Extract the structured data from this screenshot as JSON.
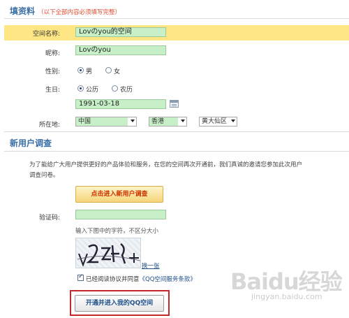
{
  "section1": {
    "title": "填资料",
    "note": "（以下全部内容必须填写完整）"
  },
  "form": {
    "space_name_label": "空间名称:",
    "space_name_value": "Lovのyou的空间",
    "nickname_label": "昵称:",
    "nickname_value": "Lovのyou",
    "gender_label": "性别:",
    "gender_male": "男",
    "gender_female": "女",
    "birthday_label": "生日:",
    "calendar_solar": "公历",
    "calendar_lunar": "农历",
    "birthday_value": "1991-03-18",
    "location_label": "所在地:",
    "country_value": "中国",
    "province_value": "香港",
    "district_value": "黄大仙区"
  },
  "section2": {
    "title": "新用户调查",
    "description_line1": "为了能给广大用户提供更好的产品体验和服务，在您的空间再次开通前，我们真诚的邀请您参加此次用户",
    "description_line2": "调查问卷。",
    "survey_button": "点击进入新用户调查",
    "captcha_label": "验证码:",
    "captcha_hint": "输入下图中的字符，不区分大小",
    "captcha_refresh": "换一张",
    "agree_text": "已经阅读协议并同意",
    "terms_link": "《QQ空间服务条款》",
    "open_button": "开通并进入我的QQ空间"
  },
  "watermark": {
    "main": "Baidu经验",
    "sub": "jingyan.baidu.com"
  },
  "colors": {
    "title_blue": "#3a6fa5",
    "highlight_yellow": "#ffe684",
    "field_green": "#c8f0c8",
    "note_red": "#e04a2f",
    "box_red": "#c4262b"
  }
}
